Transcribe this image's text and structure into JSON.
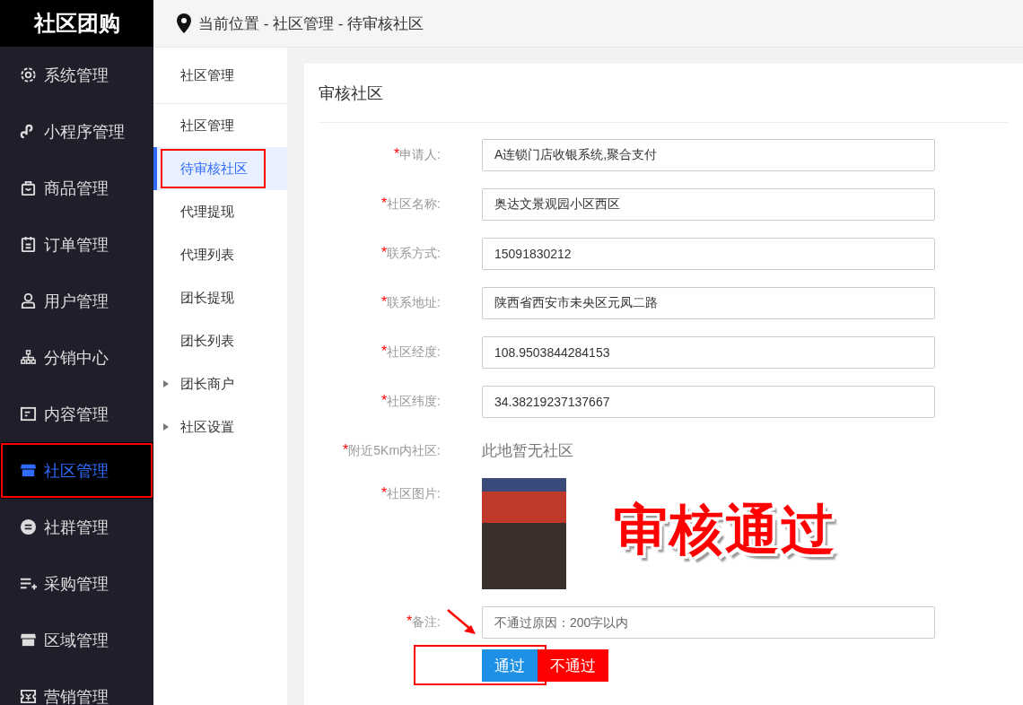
{
  "brand": "社区团购",
  "sidebar": {
    "items": [
      {
        "label": "系统管理",
        "kind": "gear",
        "selected": false,
        "annotated": false
      },
      {
        "label": "小程序管理",
        "kind": "link",
        "selected": false,
        "annotated": false
      },
      {
        "label": "商品管理",
        "kind": "bag",
        "selected": false,
        "annotated": false
      },
      {
        "label": "订单管理",
        "kind": "clipboard",
        "selected": false,
        "annotated": false
      },
      {
        "label": "用户管理",
        "kind": "user",
        "selected": false,
        "annotated": false
      },
      {
        "label": "分销中心",
        "kind": "tree",
        "selected": false,
        "annotated": false
      },
      {
        "label": "内容管理",
        "kind": "doc",
        "selected": false,
        "annotated": false
      },
      {
        "label": "社区管理",
        "kind": "shop",
        "selected": true,
        "annotated": true
      },
      {
        "label": "社群管理",
        "kind": "circle",
        "selected": false,
        "annotated": false
      },
      {
        "label": "采购管理",
        "kind": "listplus",
        "selected": false,
        "annotated": false
      },
      {
        "label": "区域管理",
        "kind": "shop",
        "selected": false,
        "annotated": false
      },
      {
        "label": "营销管理",
        "kind": "ticket",
        "selected": false,
        "annotated": false
      }
    ]
  },
  "breadcrumb": "当前位置 - 社区管理 - 待审核社区",
  "submenu": {
    "items": [
      {
        "label": "社区管理",
        "kind": "header"
      },
      {
        "label": "社区管理",
        "kind": "item",
        "selected": false,
        "annotated": false
      },
      {
        "label": "待审核社区",
        "kind": "item",
        "selected": true,
        "annotated": true
      },
      {
        "label": "代理提现",
        "kind": "item",
        "selected": false,
        "annotated": false
      },
      {
        "label": "代理列表",
        "kind": "item",
        "selected": false,
        "annotated": false
      },
      {
        "label": "团长提现",
        "kind": "item",
        "selected": false,
        "annotated": false
      },
      {
        "label": "团长列表",
        "kind": "item",
        "selected": false,
        "annotated": false
      },
      {
        "label": "团长商户",
        "kind": "group",
        "expanded": false
      },
      {
        "label": "社区设置",
        "kind": "group",
        "expanded": false
      }
    ]
  },
  "card": {
    "title": "审核社区",
    "fields": [
      {
        "label": "申请人:",
        "kind": "input",
        "required_mark": "*",
        "value": "A连锁门店收银系统,聚合支付"
      },
      {
        "label": "社区名称:",
        "kind": "input",
        "required_mark": "*",
        "value": "奥达文景观园小区西区"
      },
      {
        "label": "联系方式:",
        "kind": "input",
        "required_mark": "*",
        "value": "15091830212"
      },
      {
        "label": "联系地址:",
        "kind": "input",
        "required_mark": "*",
        "value": "陕西省西安市未央区元凤二路"
      },
      {
        "label": "社区经度:",
        "kind": "input",
        "required_mark": "*",
        "value": "108.9503844284153"
      },
      {
        "label": "社区纬度:",
        "kind": "input",
        "required_mark": "*",
        "value": "34.38219237137667"
      },
      {
        "label": "附近5Km内社区:",
        "kind": "text",
        "required_mark": "*",
        "value": "此地暂无社区"
      },
      {
        "label": "社区图片:",
        "kind": "image",
        "required_mark": "*"
      },
      {
        "label": "备注:",
        "kind": "textarea",
        "required_mark": "*",
        "placeholder": "不通过原因：200字以内"
      }
    ],
    "buttons": [
      {
        "label": "通过",
        "kind": "primary"
      },
      {
        "label": "不通过",
        "kind": "danger"
      }
    ],
    "buttons_annotated": true
  },
  "stamp": "审核通过"
}
